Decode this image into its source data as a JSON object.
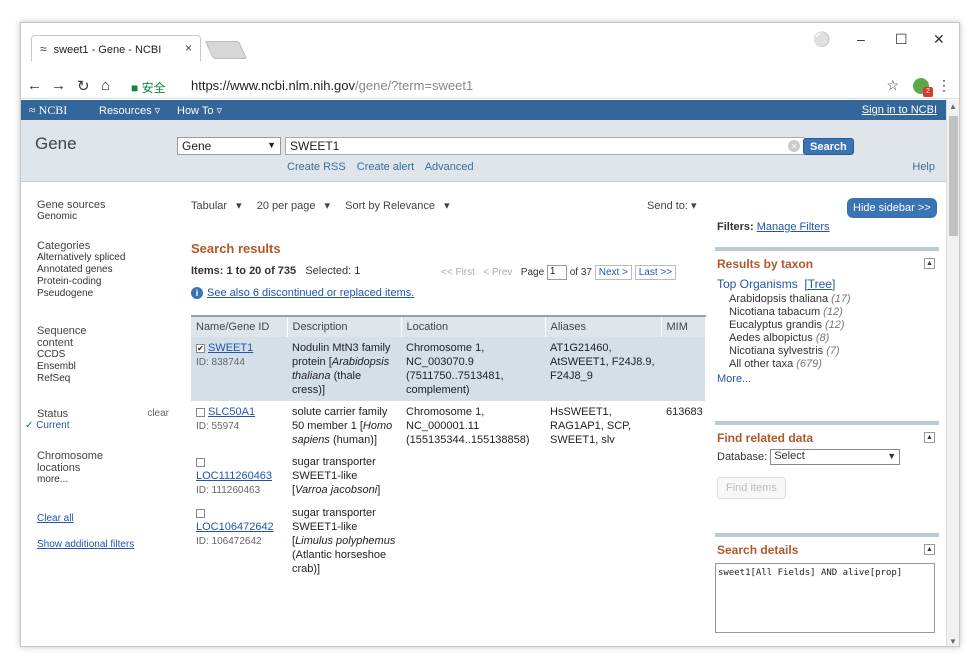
{
  "browser": {
    "tab_title": "sweet1 - Gene - NCBI",
    "tab_close": "×",
    "secure_label": "安全",
    "url_host": "https://www.ncbi.nlm.nih.gov",
    "url_path": "/gene/?term=sweet1"
  },
  "ncbi_bar": {
    "logo": "NCBI",
    "resources": "Resources",
    "howto": "How To",
    "signin": "Sign in to NCBI"
  },
  "search": {
    "title": "Gene",
    "db": "Gene",
    "term": "SWEET1",
    "button": "Search",
    "links": [
      "Create RSS",
      "Create alert",
      "Advanced"
    ],
    "help": "Help"
  },
  "left_filters": {
    "gene_sources": {
      "head": "Gene sources",
      "items": [
        "Genomic"
      ]
    },
    "categories": {
      "head": "Categories",
      "items": [
        "Alternatively spliced",
        "Annotated genes",
        "Protein-coding",
        "Pseudogene"
      ]
    },
    "sequence": {
      "head": "Sequence content",
      "items": [
        "CCDS",
        "Ensembl",
        "RefSeq"
      ]
    },
    "status": {
      "head": "Status",
      "clear": "clear",
      "current": "Current"
    },
    "chromosome": {
      "head": "Chromosome locations",
      "more": "more..."
    },
    "clear_all": "Clear all",
    "show_additional": "Show additional filters"
  },
  "toolbar": {
    "format": "Tabular",
    "per_page": "20 per page",
    "sort": "Sort by Relevance",
    "send_to": "Send to:"
  },
  "results": {
    "heading": "Search results",
    "items_label": "Items: 1 to 20 of 735",
    "selected": "Selected: 1",
    "pager": {
      "first": "<< First",
      "prev": "< Prev",
      "page_label": "Page",
      "page": "1",
      "of": "of 37",
      "next": "Next >",
      "last": "Last >>"
    },
    "see_also": "See also 6 discontinued or replaced items.",
    "columns": [
      "Name/Gene ID",
      "Description",
      "Location",
      "Aliases",
      "MIM"
    ],
    "rows": [
      {
        "name": "SWEET1",
        "id": "ID: 838744",
        "checked": "✔",
        "desc_a": "Nodulin MtN3 family protein [",
        "desc_i": "Arabidopsis thaliana",
        "desc_b": " (thale cress)]",
        "location": "Chromosome 1, NC_003070.9 (7511750..7513481, complement)",
        "aliases": "AT1G21460, AtSWEET1, F24J8.9, F24J8_9",
        "mim": ""
      },
      {
        "name": "SLC50A1",
        "id": "ID: 55974",
        "checked": "",
        "desc_a": "solute carrier family 50 member 1 [",
        "desc_i": "Homo sapiens",
        "desc_b": " (human)]",
        "location": "Chromosome 1, NC_000001.11 (155135344..155138858)",
        "aliases": "HsSWEET1, RAG1AP1, SCP, SWEET1, slv",
        "mim": "613683"
      },
      {
        "name": "LOC111260463",
        "id": "ID: 111260463",
        "checked": "",
        "desc_a": "sugar transporter SWEET1-like [",
        "desc_i": "Varroa jacobsoni",
        "desc_b": "]",
        "location": "",
        "aliases": "",
        "mim": ""
      },
      {
        "name": "LOC106472642",
        "id": "ID: 106472642",
        "checked": "",
        "desc_a": "sugar transporter SWEET1-like [",
        "desc_i": "Limulus polyphemus",
        "desc_b": " (Atlantic horseshoe crab)]",
        "location": "",
        "aliases": "",
        "mim": ""
      }
    ]
  },
  "sidebar": {
    "hide": "Hide sidebar >>",
    "filters_label": "Filters:",
    "manage_filters": "Manage Filters",
    "taxon": {
      "heading": "Results by taxon",
      "top": "Top Organisms",
      "tree": "[Tree]",
      "items": [
        {
          "name": "Arabidopsis thaliana",
          "count": "(17)"
        },
        {
          "name": "Nicotiana tabacum",
          "count": "(12)"
        },
        {
          "name": "Eucalyptus grandis",
          "count": "(12)"
        },
        {
          "name": "Aedes albopictus",
          "count": "(8)"
        },
        {
          "name": "Nicotiana sylvestris",
          "count": "(7)"
        },
        {
          "name": "All other taxa",
          "count": "(679)"
        }
      ],
      "more": "More..."
    },
    "related": {
      "heading": "Find related data",
      "db_label": "Database:",
      "db_value": "Select",
      "find": "Find items"
    },
    "details": {
      "heading": "Search details",
      "query": "sweet1[All Fields] AND alive[prop]"
    }
  }
}
